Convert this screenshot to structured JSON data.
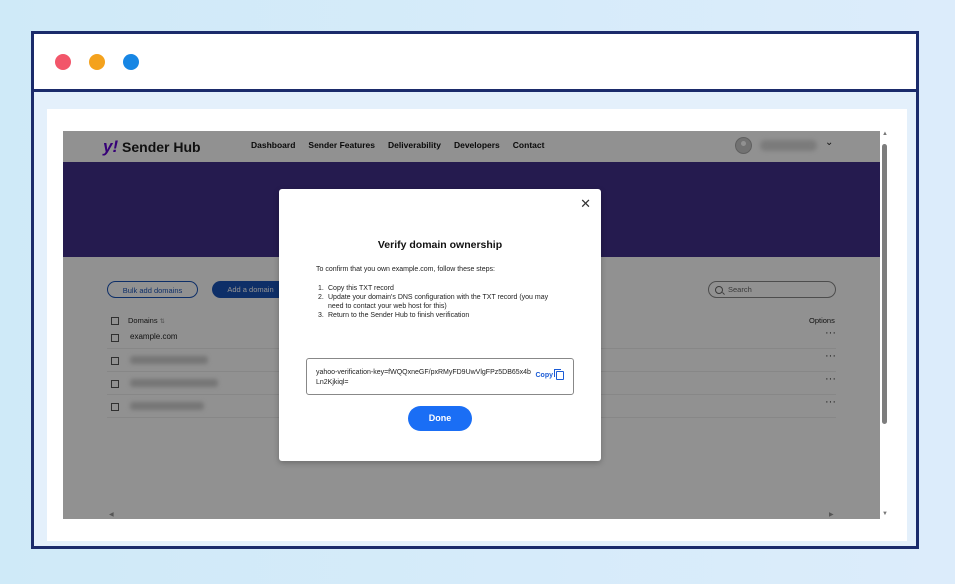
{
  "window": {
    "controls": [
      "close",
      "minimize",
      "maximize"
    ]
  },
  "app": {
    "brand": "Sender Hub",
    "brand_mark": "y!",
    "nav": [
      "Dashboard",
      "Sender Features",
      "Deliverability",
      "Developers",
      "Contact"
    ]
  },
  "toolbar": {
    "bulk_add_label": "Bulk add domains",
    "add_domain_label": "Add a domain",
    "search_placeholder": "Search"
  },
  "table": {
    "col_domains": "Domains",
    "sort_glyph": "⇅",
    "col_options": "Options",
    "rows": [
      {
        "domain": "example.com"
      },
      {
        "domain": ""
      },
      {
        "domain": ""
      },
      {
        "domain": ""
      }
    ],
    "options_glyph": "···"
  },
  "modal": {
    "close_glyph": "✕",
    "title": "Verify domain ownership",
    "intro": "To confirm that you own example.com, follow these steps:",
    "steps": [
      "Copy this TXT record",
      "Update your domain's DNS configuration with the TXT record (you may need to contact your web host for this)",
      "Return to the Sender Hub to finish verification"
    ],
    "record": "yahoo-verification-key=fWQQxneGF/pxRMyFD9UwVlgFPz5DB65x4bLn2Kjkiql=",
    "copy_label": "Copy",
    "done_label": "Done"
  },
  "colors": {
    "frame": "#1b2b6b",
    "hero": "#41318c",
    "primary": "#1a6ef5"
  }
}
